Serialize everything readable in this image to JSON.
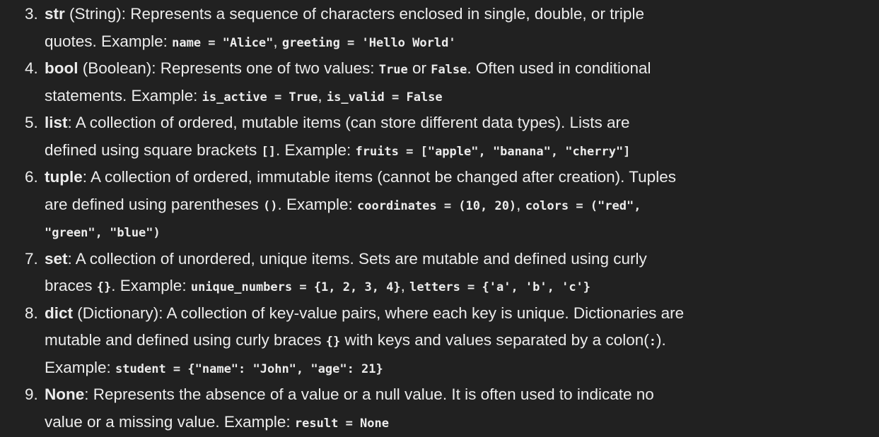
{
  "items": [
    {
      "number": "3.",
      "term": "str",
      "lines": [
        [
          " (String): Represents a sequence of characters enclosed in single, double, or triple"
        ],
        [
          "quotes. Example: ",
          {
            "code": "name = \"Alice\""
          },
          ", ",
          {
            "code": "greeting = 'Hello World'"
          }
        ]
      ]
    },
    {
      "number": "4.",
      "term": "bool",
      "lines": [
        [
          " (Boolean): Represents one of two values: ",
          {
            "code": "True"
          },
          " or ",
          {
            "code": "False"
          },
          ". Often used in conditional"
        ],
        [
          "statements. Example: ",
          {
            "code": "is_active = True"
          },
          ", ",
          {
            "code": "is_valid = False"
          }
        ]
      ]
    },
    {
      "number": "5.",
      "term": "list",
      "lines": [
        [
          ": A collection of ordered, mutable items (can store different data types). Lists are"
        ],
        [
          "defined using square brackets ",
          {
            "code": "[]"
          },
          ". Example: ",
          {
            "code": "fruits = [\"apple\", \"banana\", \"cherry\"]"
          }
        ]
      ]
    },
    {
      "number": "6.",
      "term": "tuple",
      "lines": [
        [
          ": A collection of ordered, immutable items (cannot be changed after creation). Tuples"
        ],
        [
          "are defined using parentheses ",
          {
            "code": "()"
          },
          ". Example: ",
          {
            "code": "coordinates = (10, 20)"
          },
          ", ",
          {
            "code": "colors = (\"red\","
          }
        ],
        [
          {
            "code": "\"green\", \"blue\")"
          }
        ]
      ]
    },
    {
      "number": "7.",
      "term": "set",
      "lines": [
        [
          ": A collection of unordered, unique items. Sets are mutable and defined using curly"
        ],
        [
          "braces ",
          {
            "code": "{}"
          },
          ". Example: ",
          {
            "code": "unique_numbers = {1, 2, 3, 4}"
          },
          ", ",
          {
            "code": "letters = {'a', 'b', 'c'}"
          }
        ]
      ]
    },
    {
      "number": "8.",
      "term": "dict",
      "lines": [
        [
          " (Dictionary): A collection of key-value pairs, where each key is unique. Dictionaries are"
        ],
        [
          "mutable and defined using curly braces ",
          {
            "code": "{}"
          },
          " with keys and values separated by a colon(",
          {
            "code": ":"
          },
          ")."
        ],
        [
          "Example: ",
          {
            "code": "student = {\"name\": \"John\", \"age\": 21}"
          }
        ]
      ]
    },
    {
      "number": "9.",
      "term": "None",
      "lines": [
        [
          ": Represents the absence of a value or a null value. It is often used to indicate no"
        ],
        [
          "value or a missing value. Example: ",
          {
            "code": "result = None"
          }
        ]
      ]
    }
  ],
  "colors": {
    "background": "#212121",
    "text": "#ececec"
  }
}
